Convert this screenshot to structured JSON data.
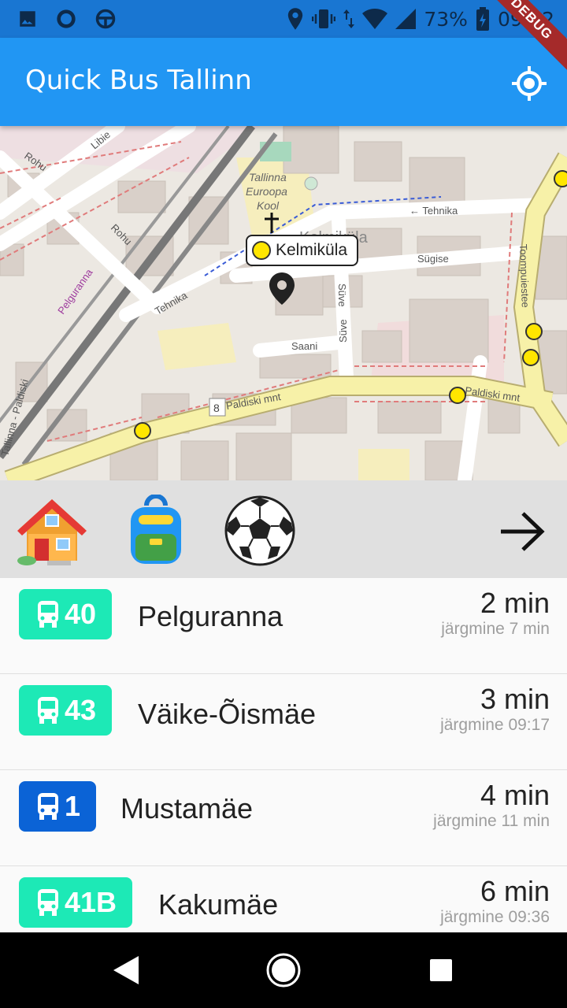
{
  "status_bar": {
    "battery_percent": "73%",
    "time": "09:02",
    "bg_color": "#1976d2"
  },
  "app_bar": {
    "title": "Quick Bus Tallinn",
    "locate_icon": "gps-locate-icon",
    "debug_label": "DEBUG",
    "bg_color": "#2196f3"
  },
  "map": {
    "stop_label": "Kelmiküla",
    "street_names": [
      "Rohu",
      "Libie",
      "Tehnika",
      "Tehnika",
      "Sügise",
      "Süve",
      "Saani",
      "Paldiski mnt",
      "Paldiski mnt",
      "Toompuiestee",
      "Pelguranna",
      "Tallinna - Paldiski",
      "Kelmiküla"
    ],
    "poi_label": [
      "Tallinna",
      "Euroopa",
      "Kool"
    ],
    "road_shield": "8"
  },
  "favorites": {
    "items": [
      {
        "icon": "house-icon",
        "label": ""
      },
      {
        "icon": "backpack-icon",
        "label": ""
      },
      {
        "icon": "soccer-ball-icon",
        "label": ""
      }
    ],
    "more_icon": "arrow-right-icon"
  },
  "departures": [
    {
      "route": "40",
      "color": "#1de9b6",
      "destination": "Pelguranna",
      "eta": "2 min",
      "next": "järgmine 7 min"
    },
    {
      "route": "43",
      "color": "#1de9b6",
      "destination": "Väike-Õismäe",
      "eta": "3 min",
      "next": "järgmine 09:17"
    },
    {
      "route": "1",
      "color": "#0b63d6",
      "destination": "Mustamäe",
      "eta": "4 min",
      "next": "järgmine 11 min"
    },
    {
      "route": "41B",
      "color": "#1de9b6",
      "destination": "Kakumäe",
      "eta": "6 min",
      "next": "järgmine 09:36"
    }
  ],
  "nav_bar": {
    "back_icon": "back-triangle-icon",
    "home_icon": "home-circle-icon",
    "recents_icon": "recents-square-icon"
  }
}
